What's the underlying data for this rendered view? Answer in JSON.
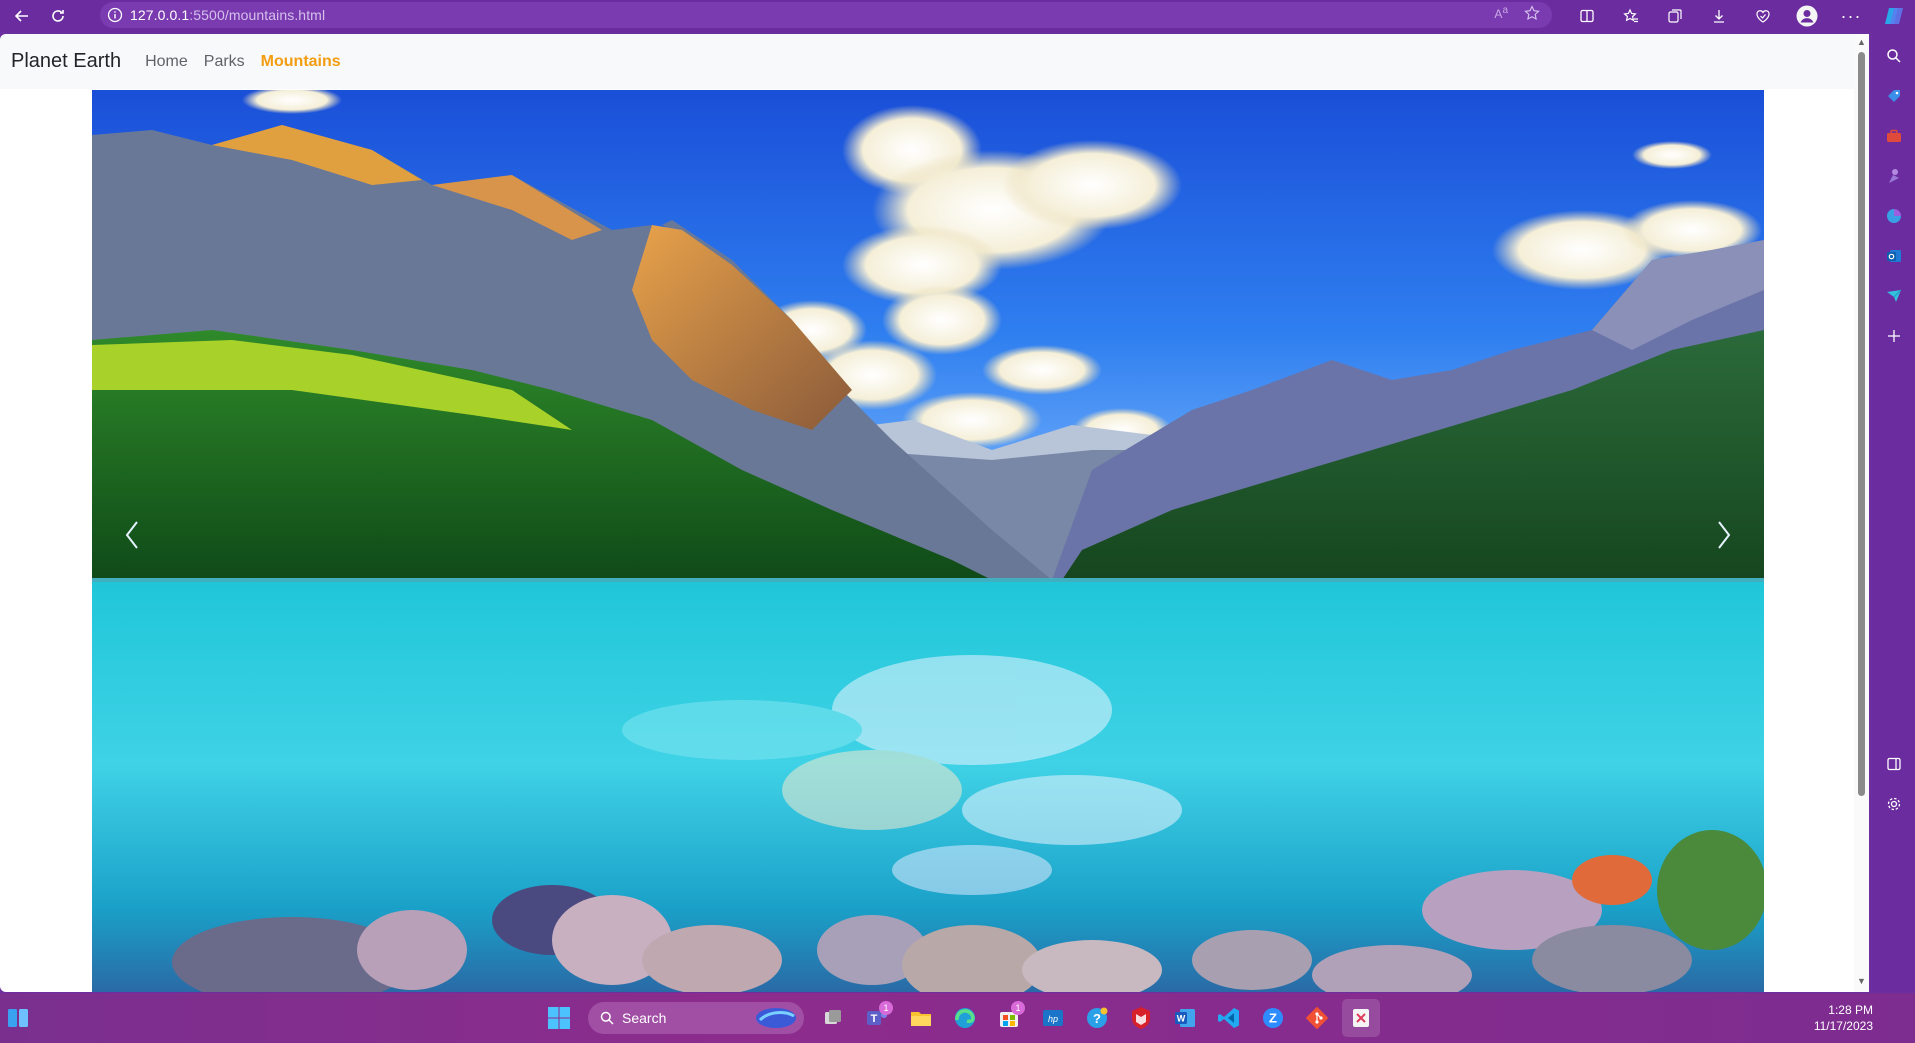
{
  "browser": {
    "url_host": "127.0.0.1",
    "url_path": ":5500/mountains.html"
  },
  "site": {
    "brand": "Planet Earth",
    "nav": [
      {
        "label": "Home",
        "active": false
      },
      {
        "label": "Parks",
        "active": false
      },
      {
        "label": "Mountains",
        "active": true
      }
    ]
  },
  "carousel": {
    "image_subject": "mountain-lake-landscape",
    "prev_icon": "chevron-left-icon",
    "next_icon": "chevron-right-icon"
  },
  "taskbar": {
    "search_label": "Search",
    "teams_badge": "1",
    "store_badge": "1",
    "time": "1:28 PM",
    "date": "11/17/2023"
  },
  "colors": {
    "browser_chrome": "#6a2c9e",
    "nav_active": "#f29d12",
    "taskbar": "#8d2c8c"
  }
}
